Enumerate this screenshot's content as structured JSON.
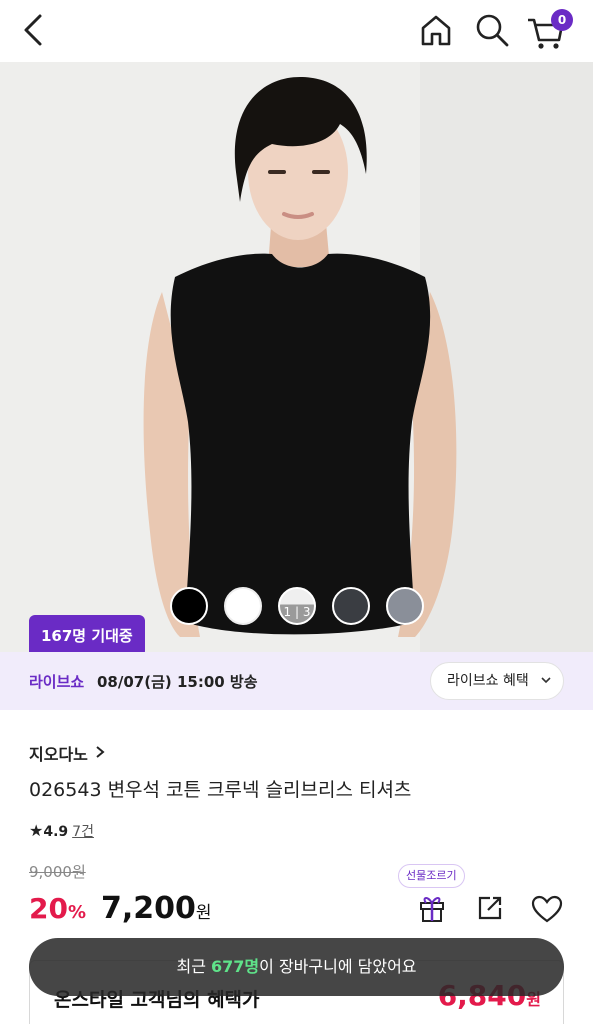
{
  "header": {
    "cart_count": "0"
  },
  "product": {
    "image_counter": "1 | 3",
    "expect_badge": "167명 기대중",
    "live_label": "라이브쇼",
    "live_time": "08/07(금) 15:00 방송",
    "live_benefit_button": "라이브쇼 혜택",
    "brand": "지오다노",
    "title": "026543 변우석 코튼 크루넥 슬리브리스 티셔츠",
    "rating_star": "★",
    "rating_score": "4.9",
    "review_count": "7건",
    "original_price": "9,000원",
    "discount_rate": "20",
    "discount_unit": "%",
    "price": "7,200",
    "price_unit": "원",
    "gift_tooltip": "선물조르기",
    "benefit_label": "온스타일 고객님의 혜택가",
    "benefit_price": "6,840",
    "benefit_unit": "원"
  },
  "toast": {
    "prefix": "최근 ",
    "highlight": "677명",
    "suffix": "이 장바구니에 담았어요"
  },
  "colors": {
    "accent": "#6a2bc5",
    "sale": "#e31a4b",
    "swatches": [
      "#000000",
      "#ffffff",
      "#d8d8d8",
      "#3a3d42",
      "#8a8f99"
    ]
  }
}
